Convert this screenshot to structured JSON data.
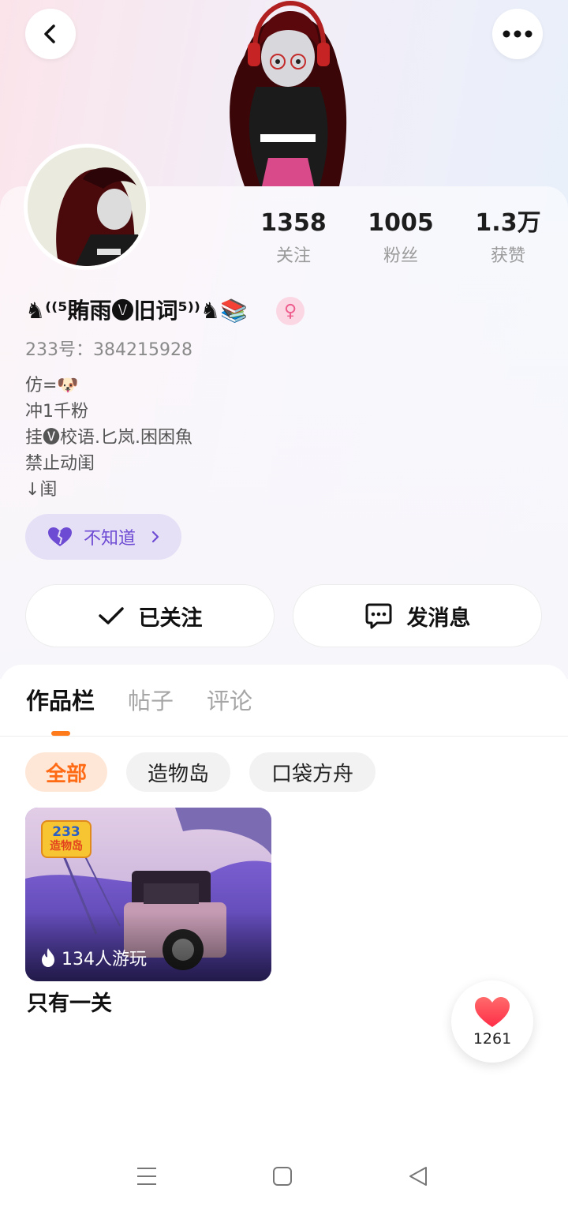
{
  "header": {
    "back_icon": "chevron-left-icon",
    "more_icon": "more-dots-icon"
  },
  "stats": [
    {
      "value": "1358",
      "label": "关注"
    },
    {
      "value": "1005",
      "label": "粉丝"
    },
    {
      "value": "1.3万",
      "label": "获赞"
    }
  ],
  "profile": {
    "username": "♞⁽⁽⁵賄雨🅥旧词⁵⁾⁾♞📚",
    "gender_symbol": "♀",
    "uid": "233号：384215928",
    "bio": [
      "仿=🐶",
      "冲1千粉",
      "挂🅥校语.匕岚.困困魚",
      "禁止动闺",
      "↓闺"
    ],
    "tag_label": "不知道"
  },
  "actions": {
    "follow_label": "已关注",
    "message_label": "发消息"
  },
  "tabs": [
    {
      "label": "作品栏",
      "active": true
    },
    {
      "label": "帖子",
      "active": false
    },
    {
      "label": "评论",
      "active": false
    }
  ],
  "filters": [
    {
      "label": "全部",
      "active": true
    },
    {
      "label": "造物岛",
      "active": false
    },
    {
      "label": "口袋方舟",
      "active": false
    }
  ],
  "works": [
    {
      "badge_line1": "233",
      "badge_line2": "造物岛",
      "play_count": "134人游玩",
      "title": "只有一关"
    }
  ],
  "like_float": {
    "count": "1261"
  },
  "colors": {
    "accent_orange": "#ff7a1a",
    "tag_purple": "#6d4bd3",
    "gender_pink": "#ee5c8c",
    "like_red": "#ff4a5a"
  }
}
